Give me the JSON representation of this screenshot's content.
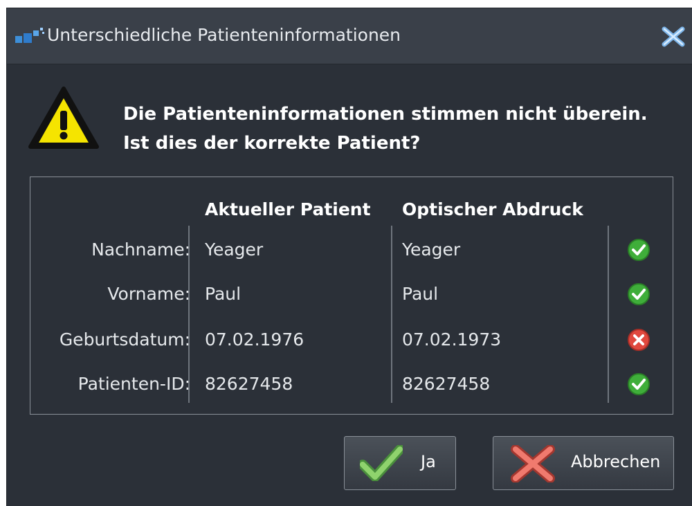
{
  "window": {
    "title": "Unterschiedliche Patienteninformationen"
  },
  "message": {
    "line1": "Die Patienteninformationen stimmen nicht überein.",
    "line2": "Ist dies der korrekte Patient?"
  },
  "table": {
    "headers": {
      "current": "Aktueller Patient",
      "optical": "Optischer Abdruck"
    },
    "rows": [
      {
        "label": "Nachname:",
        "current": "Yeager",
        "optical": "Yeager",
        "status": "match-check-icon"
      },
      {
        "label": "Vorname:",
        "current": "Paul",
        "optical": "Paul",
        "status": "match-check-icon"
      },
      {
        "label": "Geburtsdatum:",
        "current": "07.02.1976",
        "optical": "07.02.1973",
        "status": "mismatch-x-icon"
      },
      {
        "label": "Patienten-ID:",
        "current": "82627458",
        "optical": "82627458",
        "status": "match-check-icon"
      }
    ]
  },
  "buttons": {
    "yes_label": "Ja",
    "cancel_label": "Abbrechen"
  },
  "colors": {
    "background": "#2b3038",
    "titlebar": "#3a4049",
    "match": "#3fae3a",
    "mismatch": "#e0483e",
    "warning": "#f5e400"
  }
}
